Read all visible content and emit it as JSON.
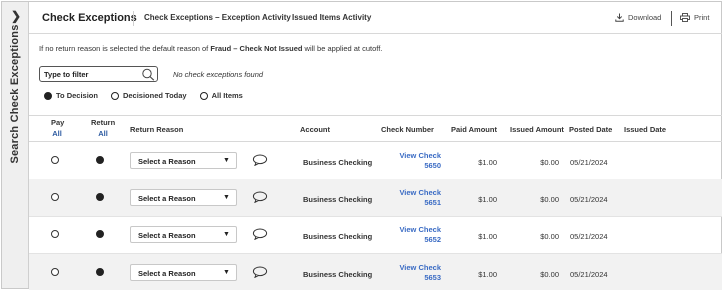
{
  "sidebar": {
    "toggle_glyph": "❯",
    "label": "Search Check Exceptions"
  },
  "header": {
    "title": "Check Exceptions",
    "tabs": [
      "Check Exceptions – Exception Activity",
      "Issued Items Activity"
    ],
    "download_label": "Download",
    "print_label": "Print"
  },
  "notice": {
    "prefix": "If no return reason is selected the default reason of ",
    "bold": "Fraud – Check Not Issued",
    "suffix": " will be applied at cutoff."
  },
  "filter": {
    "placeholder": "Type to filter",
    "empty_message": "No check exceptions found"
  },
  "view_options": [
    {
      "label": "To Decision",
      "selected": true
    },
    {
      "label": "Decisioned Today",
      "selected": false
    },
    {
      "label": "All Items",
      "selected": false
    }
  ],
  "table": {
    "columns": {
      "pay": "Pay",
      "pay_all": "All",
      "return": "Return",
      "return_all": "All",
      "return_reason": "Return Reason",
      "account": "Account",
      "check_number": "Check Number",
      "paid_amount": "Paid Amount",
      "issued_amount": "Issued Amount",
      "posted_date": "Posted Date",
      "issued_date": "Issued Date"
    },
    "rows": [
      {
        "pay": false,
        "return": true,
        "reason": "Select a Reason",
        "account": "Business Checking",
        "check_line1": "View Check",
        "check_line2": "5650",
        "paid": "$1.00",
        "issued": "$0.00",
        "posted": "05/21/2024",
        "issued_date": ""
      },
      {
        "pay": false,
        "return": true,
        "reason": "Select a Reason",
        "account": "Business Checking",
        "check_line1": "View Check",
        "check_line2": "5651",
        "paid": "$1.00",
        "issued": "$0.00",
        "posted": "05/21/2024",
        "issued_date": ""
      },
      {
        "pay": false,
        "return": true,
        "reason": "Select a Reason",
        "account": "Business Checking",
        "check_line1": "View Check",
        "check_line2": "5652",
        "paid": "$1.00",
        "issued": "$0.00",
        "posted": "05/21/2024",
        "issued_date": ""
      },
      {
        "pay": false,
        "return": true,
        "reason": "Select a Reason",
        "account": "Business Checking",
        "check_line1": "View Check",
        "check_line2": "5653",
        "paid": "$1.00",
        "issued": "$0.00",
        "posted": "05/21/2024",
        "issued_date": ""
      }
    ]
  }
}
